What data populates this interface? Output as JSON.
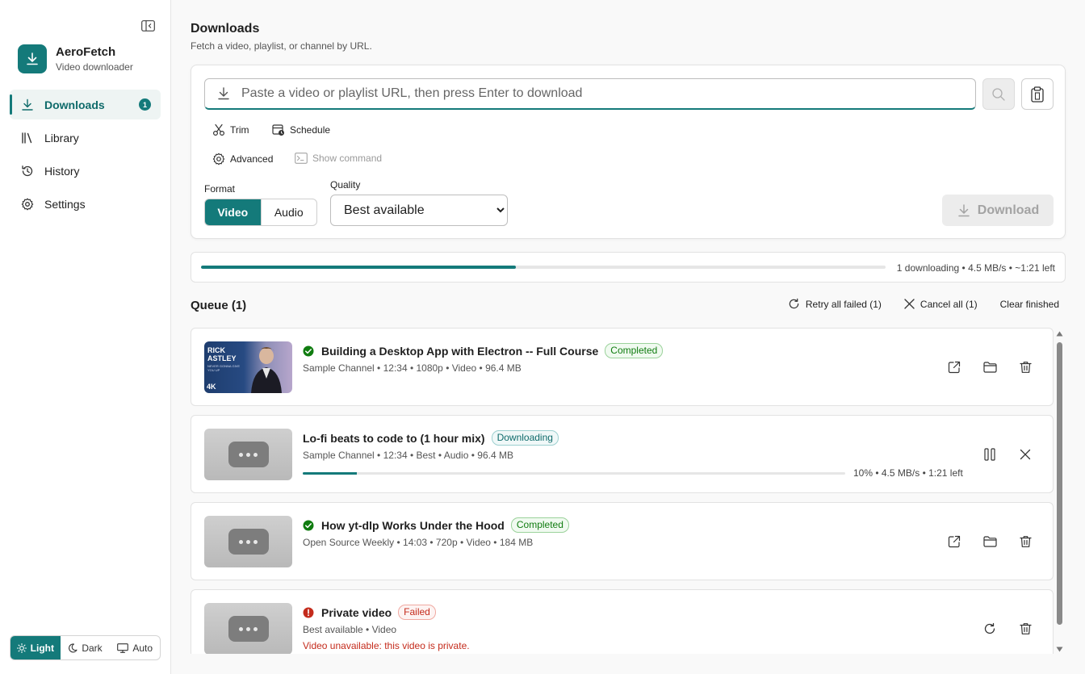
{
  "app": {
    "name": "AeroFetch",
    "tagline": "Video downloader"
  },
  "sidebar": {
    "items": [
      {
        "label": "Downloads",
        "badge": "1"
      },
      {
        "label": "Library"
      },
      {
        "label": "History"
      },
      {
        "label": "Settings"
      }
    ],
    "theme": {
      "light": "Light",
      "dark": "Dark",
      "auto": "Auto",
      "selected": "Light"
    }
  },
  "page": {
    "title": "Downloads",
    "subtitle": "Fetch a video, playlist, or channel by URL."
  },
  "url_input": {
    "value": "",
    "placeholder": "Paste a video or playlist URL, then press Enter to download"
  },
  "options": {
    "trim": "Trim",
    "schedule": "Schedule",
    "advanced": "Advanced",
    "show_command": "Show command"
  },
  "format": {
    "label": "Format",
    "video": "Video",
    "audio": "Audio",
    "selected": "Video"
  },
  "quality": {
    "label": "Quality",
    "selected": "Best available"
  },
  "download_button": "Download",
  "overall": {
    "progress": 0.46,
    "text": "1 downloading • 4.5 MB/s • ~1:21 left"
  },
  "queue": {
    "title": "Queue (1)",
    "retry_all": "Retry all failed (1)",
    "cancel_all": "Cancel all (1)",
    "clear_finished": "Clear finished",
    "items": [
      {
        "title": "Building a Desktop App with Electron -- Full Course",
        "status": "Completed",
        "meta": "Sample Channel • 12:34 • 1080p • Video • 96.4 MB",
        "thumb_text_1": "RICK",
        "thumb_text_2": "ASTLEY",
        "thumb_text_3": "NEVER GONNA GIVE YOU UP",
        "thumb_badge": "4K"
      },
      {
        "title": "Lo-fi beats to code to (1 hour mix)",
        "status": "Downloading",
        "meta": "Sample Channel • 12:34 • Best • Audio • 96.4 MB",
        "progress": 0.1,
        "progress_text": "10% • 4.5 MB/s • 1:21 left"
      },
      {
        "title": "How yt-dlp Works Under the Hood",
        "status": "Completed",
        "meta": "Open Source Weekly • 14:03 • 720p • Video • 184 MB"
      },
      {
        "title": "Private video",
        "status": "Failed",
        "meta": "Best available • Video",
        "error": "Video unavailable: this video is private."
      }
    ]
  },
  "colors": {
    "accent": "#147a7a",
    "success": "#107c10",
    "error": "#c42b1c"
  }
}
